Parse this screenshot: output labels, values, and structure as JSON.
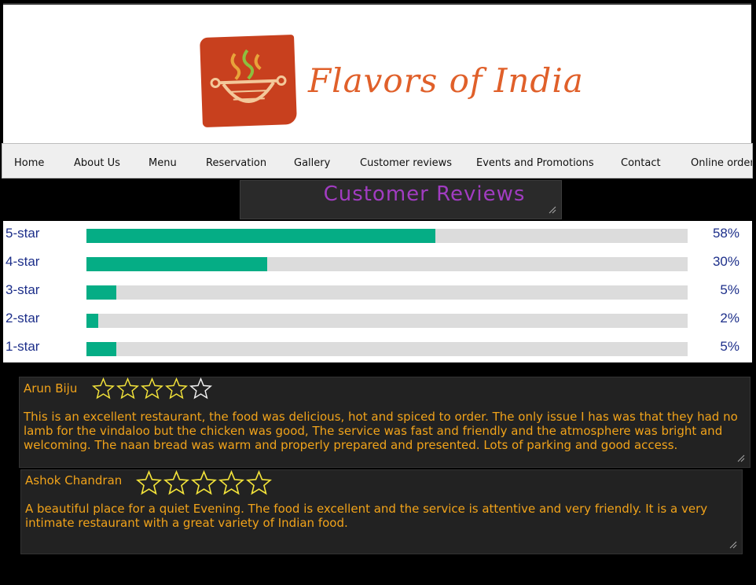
{
  "header": {
    "logo_text": "Flavors of India",
    "logo_color": "#c8401e"
  },
  "nav": {
    "items": [
      {
        "label": "Home"
      },
      {
        "label": "About Us"
      },
      {
        "label": "Menu"
      },
      {
        "label": "Reservation"
      },
      {
        "label": "Gallery"
      },
      {
        "label": "Customer reviews"
      },
      {
        "label": "Events and Promotions"
      },
      {
        "label": "Contact"
      },
      {
        "label": "Online order"
      }
    ]
  },
  "section_title": "Customer Reviews",
  "ratings": {
    "bar_color": "#05ad85",
    "rows": [
      {
        "label": "5-star",
        "percent_text": "58%",
        "fraction": 0.58
      },
      {
        "label": "4-star",
        "percent_text": "30%",
        "fraction": 0.3
      },
      {
        "label": "3-star",
        "percent_text": "5%",
        "fraction": 0.05
      },
      {
        "label": "2-star",
        "percent_text": "2%",
        "fraction": 0.02
      },
      {
        "label": "1-star",
        "percent_text": "5%",
        "fraction": 0.05
      }
    ]
  },
  "reviews": [
    {
      "name": "Arun Biju",
      "stars": 4,
      "text": "This is an excellent restaurant, the food was delicious, hot and spiced to order. The only issue I has was that they had no lamb for the vindaloo but the chicken was good, The service was fast and friendly and the atmosphere was bright and welcoming. The naan bread was warm and properly prepared and presented.  Lots of parking and good access."
    },
    {
      "name": "Ashok Chandran",
      "stars": 5,
      "text": "A beautiful place for a quiet Evening. The food is excellent and the service is attentive and very friendly. It is a very intimate restaurant with a great variety of Indian food."
    }
  ]
}
